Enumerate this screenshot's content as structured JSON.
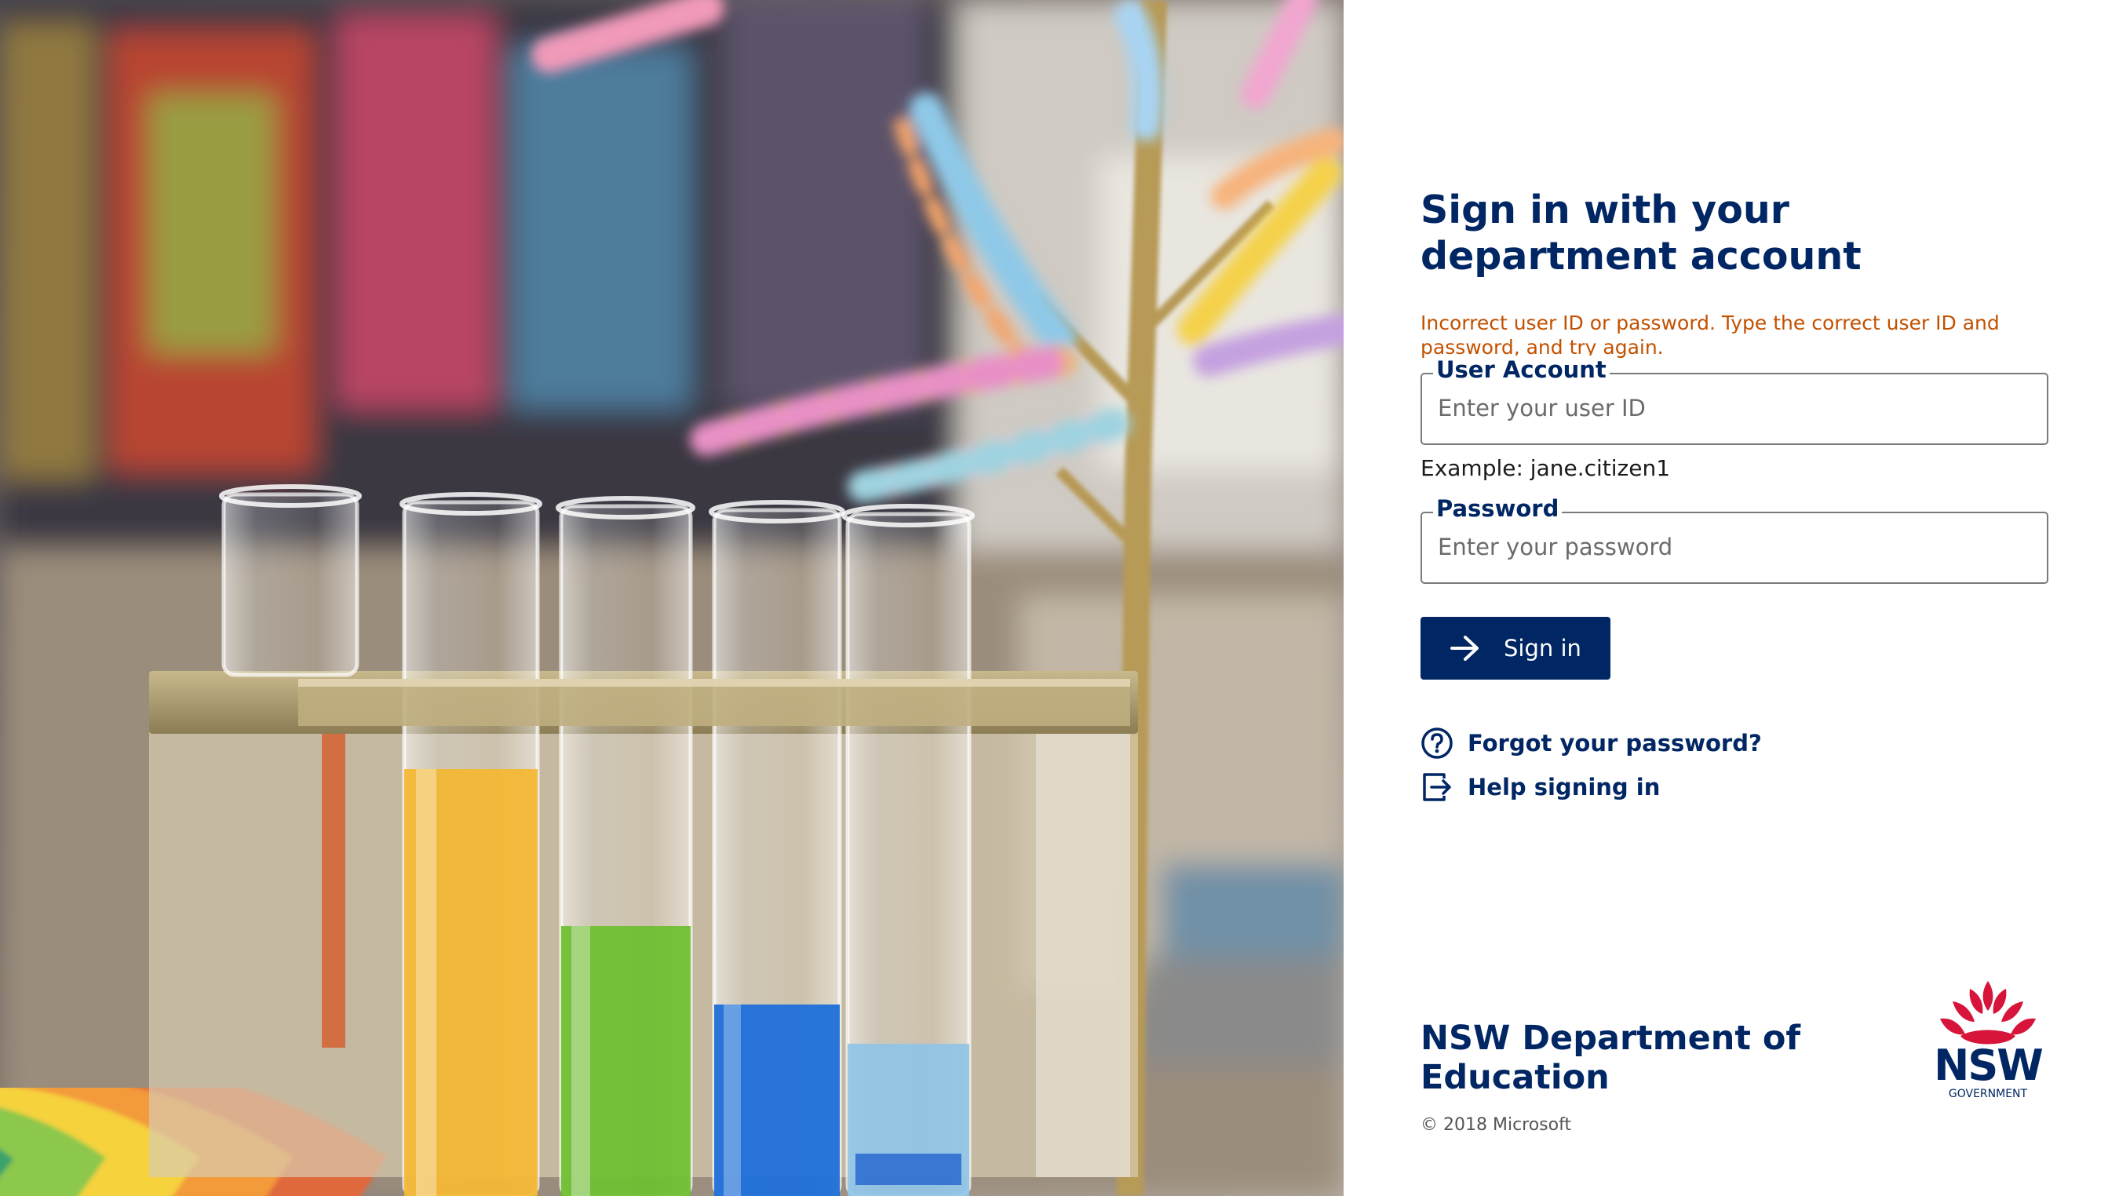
{
  "signin": {
    "title": "Sign in with your department account",
    "error_message": "Incorrect user ID or password. Type the correct user ID and password, and try again.",
    "user_field": {
      "label": "User Account",
      "placeholder": "Enter your user ID",
      "value": ""
    },
    "example_hint": "Example: jane.citizen1",
    "password_field": {
      "label": "Password",
      "placeholder": "Enter your password",
      "value": ""
    },
    "signin_button": {
      "label": "Sign in",
      "icon": "arrow-right-icon"
    },
    "links": [
      {
        "label": "Forgot your password?",
        "icon": "question-circle-icon"
      },
      {
        "label": "Help signing in",
        "icon": "exit-box-icon"
      }
    ]
  },
  "footer": {
    "org_name": "NSW Department of Education",
    "copyright": "© 2018 Microsoft",
    "logo": {
      "wordmark": "NSW",
      "subtext": "GOVERNMENT",
      "icon": "waratah-flower-icon"
    }
  },
  "colors": {
    "brand_navy": "#002664",
    "error_orange": "#c25100",
    "waratah_red": "#d7153a"
  }
}
